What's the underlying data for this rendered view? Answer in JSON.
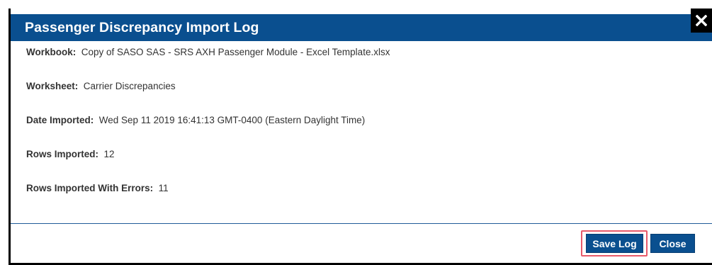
{
  "dialog": {
    "title": "Passenger Discrepancy Import Log",
    "close_icon": "close-x-icon"
  },
  "fields": [
    {
      "label": "Workbook:",
      "value": "Copy of SASO SAS - SRS AXH Passenger Module - Excel Template.xlsx"
    },
    {
      "label": "Worksheet:",
      "value": "Carrier Discrepancies"
    },
    {
      "label": "Date Imported:",
      "value": "Wed Sep 11 2019 16:41:13 GMT-0400 (Eastern Daylight Time)"
    },
    {
      "label": "Rows Imported:",
      "value": "12"
    },
    {
      "label": "Rows Imported With Errors:",
      "value": "11"
    }
  ],
  "buttons": {
    "save_label": "Save Log",
    "close_label": "Close"
  },
  "colors": {
    "header": "#0a4f8f",
    "highlight": "#e85a6a"
  }
}
